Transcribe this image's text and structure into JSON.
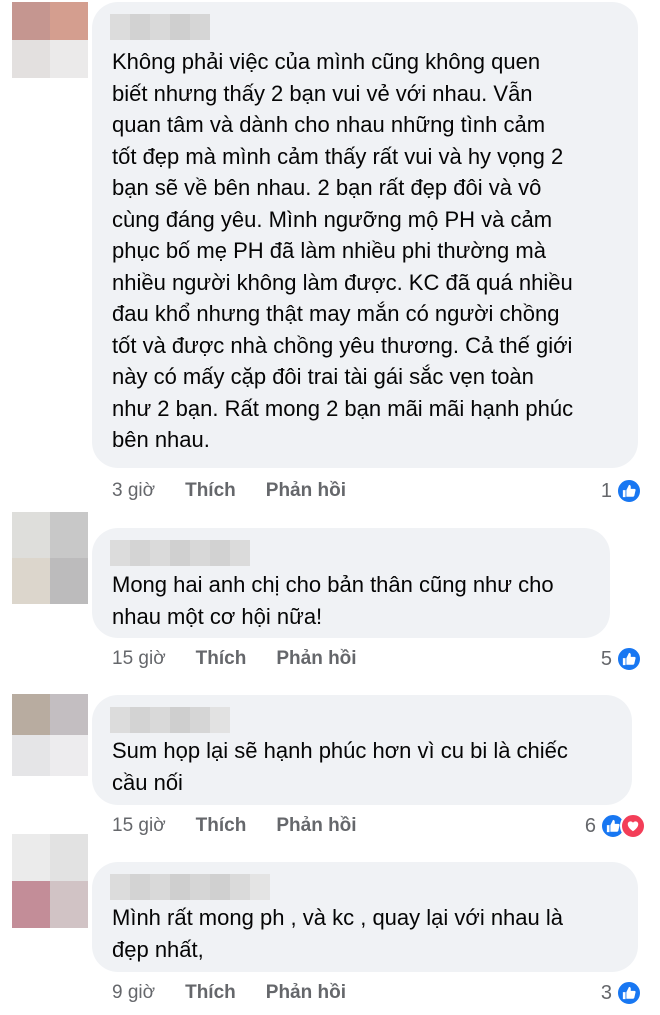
{
  "comments": [
    {
      "text": "Không phải việc của mình cũng không quen\nbiết nhưng thấy 2 bạn vui vẻ với nhau. Vẫn\nquan tâm và dành cho nhau những tình cảm\ntốt đẹp mà mình cảm thấy rất vui và hy vọng 2\nbạn sẽ về bên nhau. 2 bạn rất đẹp đôi và vô\ncùng đáng yêu. Mình ngưỡng mộ PH và cảm\nphục bố mẹ PH đã làm nhiều phi thường mà\nnhiều người không làm được. KC đã quá nhiều\nđau khổ nhưng thật may mắn có người chồng\ntốt và được nhà chồng yêu thương. Cả thế giới\nnày có mấy cặp đôi trai tài gái sắc vẹn toàn\nnhư 2 bạn. Rất mong 2 bạn mãi mãi hạnh phúc\nbên nhau.",
      "time": "3 giờ",
      "like_label": "Thích",
      "reply_label": "Phản hồi",
      "reaction_count": "1",
      "reactions": [
        "like"
      ]
    },
    {
      "text": "Mong hai anh chị cho bản thân cũng như cho\nnhau một cơ hội nữa!",
      "time": "15 giờ",
      "like_label": "Thích",
      "reply_label": "Phản hồi",
      "reaction_count": "5",
      "reactions": [
        "like"
      ]
    },
    {
      "text": "Sum họp lại sẽ hạnh phúc hơn vì cu bi là chiếc\ncầu nối",
      "time": "15 giờ",
      "like_label": "Thích",
      "reply_label": "Phản hồi",
      "reaction_count": "6",
      "reactions": [
        "like",
        "love"
      ]
    },
    {
      "text": "Mình rất mong ph , và kc , quay lại với nhau là\nđẹp nhất,",
      "time": "9 giờ",
      "like_label": "Thích",
      "reply_label": "Phản hồi",
      "reaction_count": "3",
      "reactions": [
        "like"
      ]
    }
  ],
  "colors": {
    "bubble": "#f0f2f5",
    "meta_text": "#65676b",
    "like": "#1877f2",
    "love": "#f33e58"
  }
}
